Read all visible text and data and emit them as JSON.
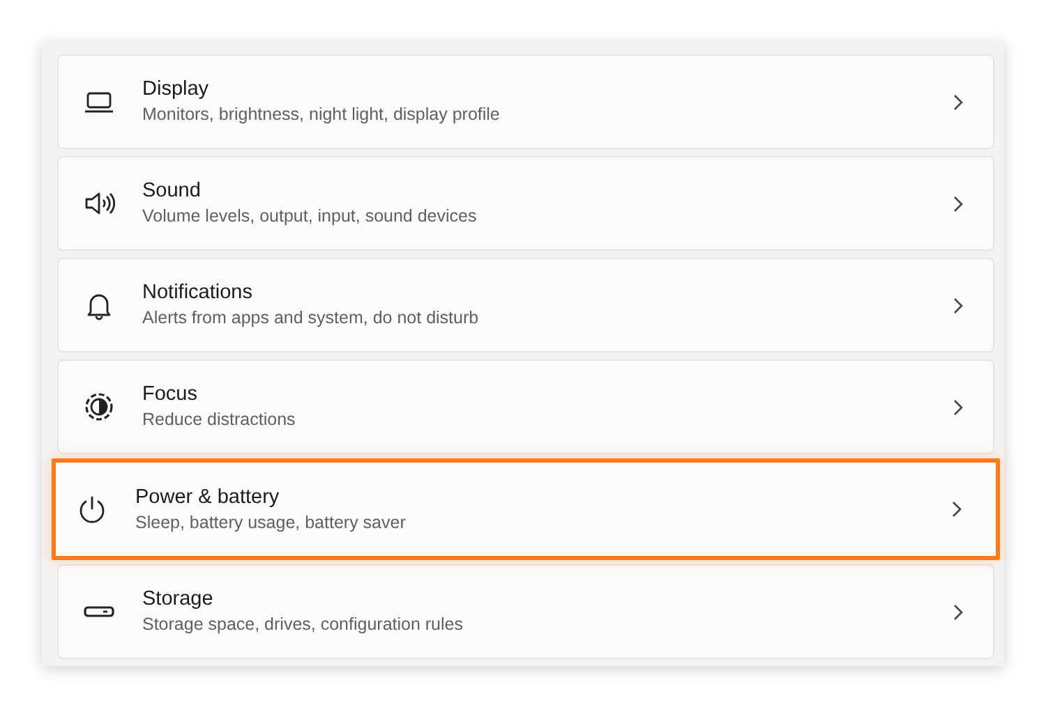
{
  "settings_items": [
    {
      "kind": "display",
      "title": "Display",
      "description": "Monitors, brightness, night light, display profile",
      "highlighted": false
    },
    {
      "kind": "sound",
      "title": "Sound",
      "description": "Volume levels, output, input, sound devices",
      "highlighted": false
    },
    {
      "kind": "notifications",
      "title": "Notifications",
      "description": "Alerts from apps and system, do not disturb",
      "highlighted": false
    },
    {
      "kind": "focus",
      "title": "Focus",
      "description": "Reduce distractions",
      "highlighted": false
    },
    {
      "kind": "power",
      "title": "Power & battery",
      "description": "Sleep, battery usage, battery saver",
      "highlighted": true
    },
    {
      "kind": "storage",
      "title": "Storage",
      "description": "Storage space, drives, configuration rules",
      "highlighted": false
    }
  ]
}
